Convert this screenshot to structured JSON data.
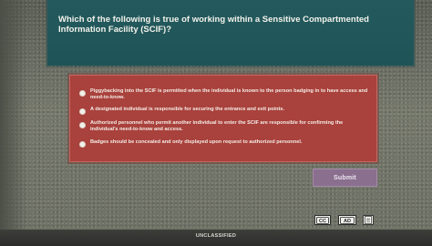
{
  "question": {
    "text": "Which of the following is true of working within a Sensitive Compartmented Information Facility (SCIF)?"
  },
  "options": [
    {
      "label": "Piggybacking into the SCIF is permitted when the individual is known to the person badging in to have access and need-to-know."
    },
    {
      "label": "A designated individual is responsible for securing the entrance and exit points."
    },
    {
      "label": "Authorized personnel who permit another individual to enter the SCIF are responsible for confirming the individual's need-to-know and access."
    },
    {
      "label": "Badges should be concealed and only displayed upon request to authorized personnel."
    }
  ],
  "submit": {
    "label": "Submit"
  },
  "toolbar": {
    "cc_label": "CC",
    "ad_label": "AD",
    "cc_icon": "closed-captions-icon",
    "ad_icon": "audio-description-icon",
    "doc_icon": "document-icon"
  },
  "footer": {
    "text": "UNCLASSIFIED"
  },
  "colors": {
    "question_panel": "#245a5e",
    "answer_panel": "#a9413c",
    "submit_button": "#8a6f8f",
    "footer_bar": "#2d2e2b"
  }
}
